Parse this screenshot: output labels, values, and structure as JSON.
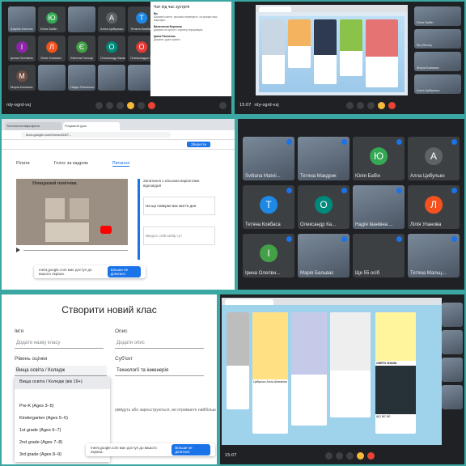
{
  "colors": {
    "frame": "#3aa7a2",
    "meet_bg": "#202124",
    "tile": "#3c4043",
    "accent": "#1a73e8",
    "red": "#ea4335"
  },
  "panel1": {
    "meeting_code": "rdy-ogrd-vxj",
    "tiles": [
      {
        "initial": "",
        "name": "Шарба Євгенія",
        "color": "#5f6368"
      },
      {
        "initial": "Ю",
        "name": "Юлія Бабін",
        "color": "#34a853"
      },
      {
        "initial": "",
        "name": "",
        "color": "#5f6368"
      },
      {
        "initial": "А",
        "name": "Алла Цибулько",
        "color": "#5f6368"
      },
      {
        "initial": "Т",
        "name": "Тетяна Ковбаса",
        "color": "#1e88e5"
      },
      {
        "initial": "І",
        "name": "Ірина Олегівна",
        "color": "#8e24aa"
      },
      {
        "initial": "Л",
        "name": "Лілія Уланова",
        "color": "#f4511e"
      },
      {
        "initial": "Є",
        "name": "Євгенія Гончар",
        "color": "#43a047"
      },
      {
        "initial": "О",
        "name": "Олександр Кальний",
        "color": "#00897b"
      },
      {
        "initial": "О",
        "name": "Олександра Кальна",
        "color": "#e53935"
      },
      {
        "initial": "М",
        "name": "Марія Бальвас",
        "color": "#6d4c41"
      },
      {
        "initial": "",
        "name": "",
        "color": "#5f6368"
      },
      {
        "initial": "",
        "name": "Надія Панченко",
        "color": "#5f6368"
      },
      {
        "initial": "",
        "name": "",
        "color": "#5f6368"
      },
      {
        "initial": "",
        "name": "",
        "color": "#5f6368"
      }
    ],
    "chat_title": "Чат під час зустрічі",
    "chat_messages": [
      {
        "sender": "Ви",
        "text": "Шановні колеги, просимо перевірити, чи працює ваш мікрофон."
      },
      {
        "sender": "Валентина Бережна",
        "text": "Дякуємо за зустріч і корисну інформацію."
      },
      {
        "sender": "Ірина Панченко",
        "text": "Дякуємо, дуже цікаво!"
      }
    ]
  },
  "panel2": {
    "meeting_code": "rdy-ogrd-vxj",
    "time": "15:07",
    "right_tiles": [
      {
        "initial": "",
        "name": "Юлія Бабін"
      },
      {
        "initial": "",
        "name": "Ви (Show)"
      },
      {
        "initial": "",
        "name": "Марія Бальвас"
      },
      {
        "initial": "",
        "name": "Алла Цибулько"
      }
    ]
  },
  "panel3": {
    "tabs": [
      "Технологія мікрофона",
      "Розумний урок"
    ],
    "url": "docs.google.com/forms/d/1BT...",
    "video_tabs": [
      "Рілати",
      "Голос за кадром",
      "Питання"
    ],
    "video_title": "Невидимий помічник",
    "question_label": "Запитання з кількома варіантами відповідей",
    "question_text": "На що поверне вас життя дня",
    "answer_placeholder": "Введіть свій вибір тут",
    "save_button": "Зберегти",
    "banner_text": "meet.google.com має доступ до вашого екрана.",
    "banner_button": "Більше не ділитися"
  },
  "panel4": {
    "tiles": [
      {
        "initial": "",
        "name": "Svitlana Matvii...",
        "color": "#5f6368",
        "photo": true
      },
      {
        "initial": "",
        "name": "Тетяна Макдрик",
        "color": "#5f6368",
        "photo": true
      },
      {
        "initial": "Ю",
        "name": "Юлія Бабін",
        "color": "#34a853",
        "photo": false
      },
      {
        "initial": "А",
        "name": "Алла Цибулько",
        "color": "#5f6368",
        "photo": false
      },
      {
        "initial": "Т",
        "name": "Тетяна Ковбаса",
        "color": "#1e88e5",
        "photo": false
      },
      {
        "initial": "О",
        "name": "Олександр Ка...",
        "color": "#00897b",
        "photo": false
      },
      {
        "initial": "",
        "name": "Надія Іванівна ...",
        "color": "#5f6368",
        "photo": true
      },
      {
        "initial": "Л",
        "name": "Лілія Уланова",
        "color": "#f4511e",
        "photo": false
      },
      {
        "initial": "І",
        "name": "Ірина Олегівн...",
        "color": "#43a047",
        "photo": false
      },
      {
        "initial": "",
        "name": "Марія Бальвас",
        "color": "#5f6368",
        "photo": true
      },
      {
        "initial": "",
        "name": "Ще 55 осіб",
        "color": "#5f6368",
        "photo": false
      },
      {
        "initial": "",
        "name": "Тетяна Мальц...",
        "color": "#5f6368",
        "photo": true
      }
    ]
  },
  "panel5": {
    "title": "Створити новий клас",
    "name_label": "Ім'я",
    "name_placeholder": "Додати назву класу",
    "desc_label": "Опис",
    "desc_placeholder": "Додати опис",
    "level_label": "Рівень оцінки",
    "level_value": "Вища освіта / Коледж",
    "subject_label": "Суб'єкт",
    "subject_value": "Технології та інженерія",
    "options": [
      "Вища освіта / Коледж (вік 19+)",
      "",
      "Pre-K (Ages 3–5)",
      "Kindergarten (Ages 5–6)",
      "1st grade (Ages 6–7)",
      "2nd grade (Ages 7–8)",
      "3rd grade (Ages 8–9)"
    ],
    "hint": "увійдуть або зареєструються, ви отримаєте найбільш",
    "banner_text": "meet.google.com має доступ до вашого екрана.",
    "banner_button": "Більше не ділитися"
  },
  "panel6": {
    "time": "15:07",
    "card_title": "СВЯТО ЗНАНЬ",
    "footer": "ЩО ВЄ ВЄ",
    "names": [
      "Цибулько Алла Шевченко",
      "Юлія Бабін"
    ]
  }
}
